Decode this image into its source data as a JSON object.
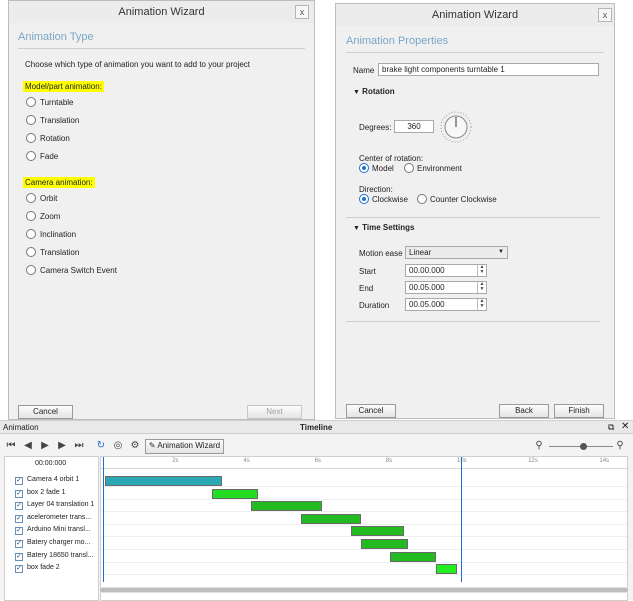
{
  "wizard_left": {
    "title": "Animation Wizard",
    "close": "x",
    "section_title": "Animation Type",
    "instruction": "Choose which type of animation you want to add to your project",
    "model_heading": "Model/part animation:",
    "model_options": [
      "Turntable",
      "Translation",
      "Rotation",
      "Fade"
    ],
    "camera_heading": "Camera animation:",
    "camera_options": [
      "Orbit",
      "Zoom",
      "Inclination",
      "Translation",
      "Camera Switch Event"
    ],
    "cancel": "Cancel",
    "next": "Next"
  },
  "wizard_right": {
    "title": "Animation Wizard",
    "close": "x",
    "section_title": "Animation Properties",
    "name_label": "Name",
    "name_value": "brake light components turntable 1",
    "rotation_heading": "Rotation",
    "degrees_label": "Degrees:",
    "degrees_value": "360",
    "center_label": "Center of rotation:",
    "center_options": [
      "Model",
      "Environment"
    ],
    "center_selected": "Model",
    "direction_label": "Direction:",
    "direction_options": [
      "Clockwise",
      "Counter Clockwise"
    ],
    "direction_selected": "Clockwise",
    "time_heading": "Time Settings",
    "motion_ease_label": "Motion ease",
    "motion_ease_value": "Linear",
    "start_label": "Start",
    "start_value": "00.00.000",
    "end_label": "End",
    "end_value": "00.05.000",
    "duration_label": "Duration",
    "duration_value": "00.05.000",
    "cancel": "Cancel",
    "back": "Back",
    "finish": "Finish"
  },
  "timeline": {
    "panel_label": "Animation",
    "title": "Timeline",
    "wizard_button": "Animation Wizard",
    "time_readout": "00:00:000",
    "ruler_labels": [
      "2s",
      "4s",
      "6s",
      "8s",
      "10s",
      "12s",
      "14s"
    ],
    "tracks": [
      {
        "label": "Camera 4 orbit 1",
        "start": 0.0,
        "end": 3.3,
        "color": "#2aa8b5"
      },
      {
        "label": "box 2 fade 1",
        "start": 3.0,
        "end": 4.3,
        "color": "#22dd22"
      },
      {
        "label": "Layer 04 translation 1",
        "start": 4.1,
        "end": 6.1,
        "color": "#22bb22"
      },
      {
        "label": "acelerometer trans...",
        "start": 5.5,
        "end": 7.2,
        "color": "#22bb22"
      },
      {
        "label": "Arduino Mini transl...",
        "start": 6.9,
        "end": 8.4,
        "color": "#22bb22"
      },
      {
        "label": "Batery charger mo...",
        "start": 7.2,
        "end": 8.5,
        "color": "#22bb22"
      },
      {
        "label": "Batery 18650 transl...",
        "start": 8.0,
        "end": 9.3,
        "color": "#22bb22"
      },
      {
        "label": "box fade 2",
        "start": 9.3,
        "end": 9.9,
        "color": "#22ee22"
      }
    ],
    "duration_seconds": 14.7,
    "playhead_seconds": 10.0
  }
}
